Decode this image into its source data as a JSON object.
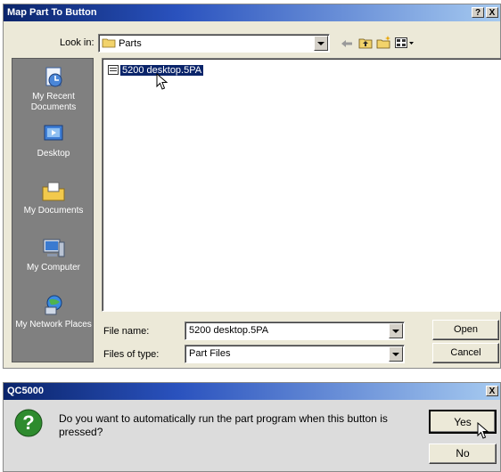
{
  "dialog1": {
    "title": "Map Part To Button",
    "help_label": "?",
    "close_label": "X",
    "look_in_label": "Look in:",
    "look_in_value": "Parts",
    "places": [
      {
        "label": "My Recent Documents",
        "icon": "recent-documents-icon"
      },
      {
        "label": "Desktop",
        "icon": "desktop-icon"
      },
      {
        "label": "My Documents",
        "icon": "my-documents-icon"
      },
      {
        "label": "My Computer",
        "icon": "my-computer-icon"
      },
      {
        "label": "My Network Places",
        "icon": "network-places-icon"
      }
    ],
    "files": [
      {
        "name": "5200 desktop.5PA"
      }
    ],
    "file_name_label": "File name:",
    "file_name_value": "5200 desktop.5PA",
    "file_type_label": "Files of type:",
    "file_type_value": "Part Files",
    "open_label": "Open",
    "cancel_label": "Cancel"
  },
  "dialog2": {
    "title": "QC5000",
    "close_label": "X",
    "message": "Do you want to automatically run the part program when this button is pressed?",
    "yes_label": "Yes",
    "no_label": "No"
  }
}
